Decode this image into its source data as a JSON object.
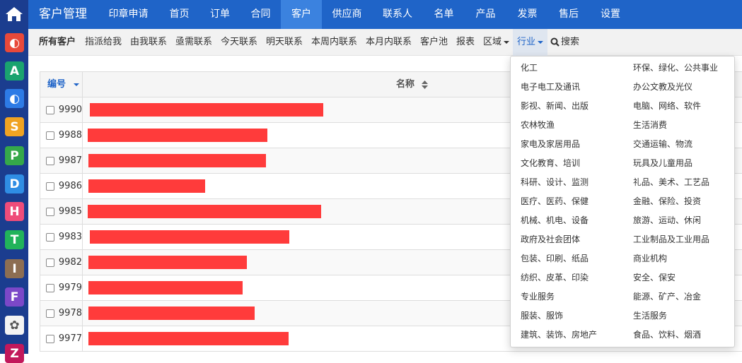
{
  "rail": {
    "apps": [
      {
        "letter": "◐",
        "color": "#e8493a"
      },
      {
        "letter": "A",
        "color": "#1aa36f"
      },
      {
        "letter": "◐",
        "color": "#2d7be6"
      },
      {
        "letter": "S",
        "color": "#f0a322"
      },
      {
        "letter": "P",
        "color": "#35a84a"
      },
      {
        "letter": "D",
        "color": "#2f8de4"
      },
      {
        "letter": "H",
        "color": "#ef4c7a"
      },
      {
        "letter": "T",
        "color": "#21b35a"
      },
      {
        "letter": "I",
        "color": "#8d6e52"
      },
      {
        "letter": "F",
        "color": "#7b48c8"
      },
      {
        "letter": "✿",
        "color": "#f3f3f3"
      },
      {
        "letter": "Z",
        "color": "#c2185b"
      }
    ]
  },
  "topnav": {
    "brand": "客户管理",
    "items": [
      "印章申请",
      "首页",
      "订单",
      "合同",
      "客户",
      "供应商",
      "联系人",
      "名单",
      "产品",
      "发票",
      "售后",
      "设置"
    ],
    "active": "客户"
  },
  "subnav": {
    "items": [
      "所有客户",
      "指派给我",
      "由我联系",
      "亟需联系",
      "今天联系",
      "明天联系",
      "本周内联系",
      "本月内联系",
      "客户池",
      "报表",
      "区域",
      "行业",
      "搜索"
    ]
  },
  "table": {
    "col_id": "编号",
    "col_name": "名称",
    "rows": [
      {
        "id": "9990",
        "bar_fraction": 0.33
      },
      {
        "id": "9988",
        "bar_fraction": 0.254
      },
      {
        "id": "9987",
        "bar_fraction": 0.251
      },
      {
        "id": "9986",
        "bar_fraction": 0.165
      },
      {
        "id": "9985",
        "bar_fraction": 0.33
      },
      {
        "id": "9983",
        "bar_fraction": 0.282
      },
      {
        "id": "9982",
        "bar_fraction": 0.224
      },
      {
        "id": "9979",
        "bar_fraction": 0.218
      },
      {
        "id": "9978",
        "bar_fraction": 0.235
      },
      {
        "id": "9977",
        "bar_fraction": 0.283
      }
    ]
  },
  "dropdown": {
    "left": [
      "化工",
      "电子电工及通讯",
      "影视、新闻、出版",
      "农林牧渔",
      "家电及家居用品",
      "文化教育、培训",
      "科研、设计、监测",
      "医疗、医药、保健",
      "机械、机电、设备",
      "政府及社会团体",
      "包装、印刷、纸品",
      "纺织、皮革、印染",
      "专业服务",
      "服装、服饰",
      "建筑、装饰、房地产"
    ],
    "right": [
      "环保、绿化、公共事业",
      "办公文教及光仪",
      "电脑、网络、软件",
      "生活消费",
      "交通运输、物流",
      "玩具及儿童用品",
      "礼品、美术、工艺品",
      "金融、保险、投资",
      "旅游、运动、休闲",
      "工业制品及工业用品",
      "商业机构",
      "安全、保安",
      "能源、矿产、冶金",
      "生活服务",
      "食品、饮料、烟酒"
    ]
  }
}
